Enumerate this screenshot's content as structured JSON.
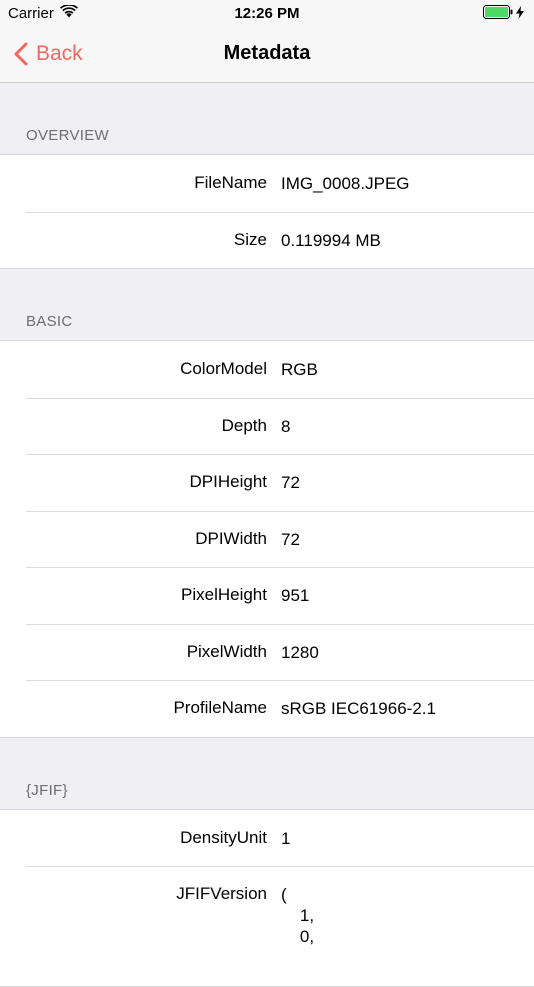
{
  "status_bar": {
    "carrier": "Carrier",
    "time": "12:26 PM",
    "battery_level": 1.0,
    "battery_color": "#4cd964"
  },
  "nav": {
    "back_label": "Back",
    "title": "Metadata",
    "accent_color": "#f0695f"
  },
  "sections": [
    {
      "header": "OVERVIEW",
      "rows": [
        {
          "key": "FileName",
          "value": "IMG_0008.JPEG"
        },
        {
          "key": "Size",
          "value": "0.119994 MB"
        }
      ]
    },
    {
      "header": "BASIC",
      "rows": [
        {
          "key": "ColorModel",
          "value": "RGB"
        },
        {
          "key": "Depth",
          "value": "8"
        },
        {
          "key": "DPIHeight",
          "value": "72"
        },
        {
          "key": "DPIWidth",
          "value": "72"
        },
        {
          "key": "PixelHeight",
          "value": "951"
        },
        {
          "key": "PixelWidth",
          "value": "1280"
        },
        {
          "key": "ProfileName",
          "value": "sRGB IEC61966-2.1"
        }
      ]
    },
    {
      "header": "{JFIF}",
      "rows": [
        {
          "key": "DensityUnit",
          "value": "1"
        },
        {
          "key": "JFIFVersion",
          "value": "(\n    1,\n    0,"
        }
      ]
    }
  ]
}
